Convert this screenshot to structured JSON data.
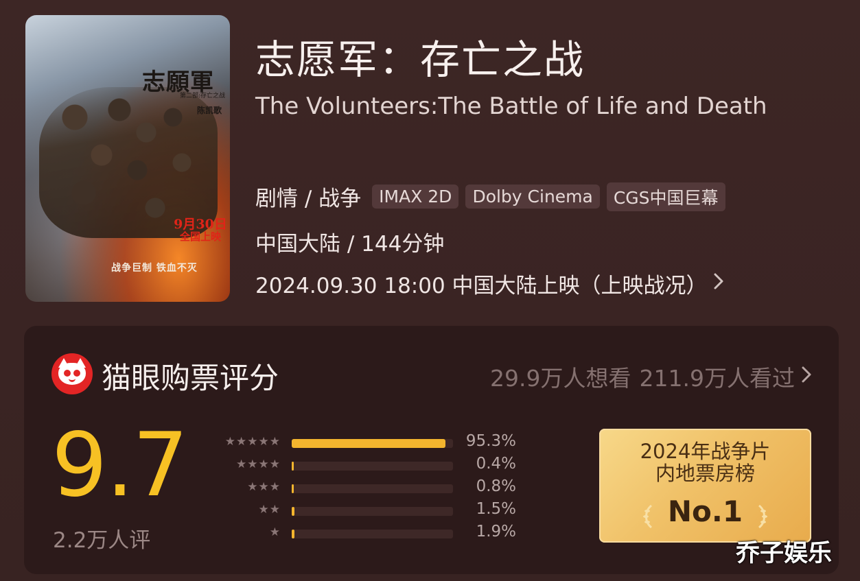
{
  "poster": {
    "title": "志願軍",
    "subtitle": "第二部:存亡之战",
    "director": "陈凯歌",
    "date_line1": "9月30日",
    "date_line2": "全国上映",
    "slogan": "战争巨制 铁血不灭"
  },
  "movie": {
    "title_cn": "志愿军：存亡之战",
    "title_en": "The Volunteers:The Battle of Life and Death",
    "genre": "剧情 / 战争",
    "tags": [
      "IMAX 2D",
      "Dolby Cinema",
      "CGS中国巨幕"
    ],
    "region_duration": "中国大陆 / 144分钟",
    "release": "2024.09.30 18:00 中国大陆上映（上映战况）"
  },
  "rating": {
    "title": "猫眼购票评分",
    "want": "29.9万人想看",
    "watched": "211.9万人看过",
    "score": "9.7",
    "voters": "2.2万人评",
    "distribution": [
      {
        "stars": "★★★★★",
        "percent_label": "95.3%",
        "value": 95.3
      },
      {
        "stars": "★★★★",
        "percent_label": "0.4%",
        "value": 0.4
      },
      {
        "stars": "★★★",
        "percent_label": "0.8%",
        "value": 0.8
      },
      {
        "stars": "★★",
        "percent_label": "1.5%",
        "value": 1.5
      },
      {
        "stars": "★",
        "percent_label": "1.9%",
        "value": 1.9
      }
    ]
  },
  "rank_badge": {
    "line1": "2024年战争片",
    "line2": "内地票房榜",
    "rank": "No.1"
  },
  "watermark": "乔子娱乐",
  "colors": {
    "background": "#3a2423",
    "card": "#2c1a1a",
    "score": "#f7c124",
    "bar_fill": "#f4b52e",
    "logo": "#e32525",
    "badge": "#f0c168"
  },
  "icons": {
    "chevron": "chevron-right-icon",
    "logo": "maoyan-cat-logo-icon",
    "star": "star-icon",
    "laurel": "laurel-icon"
  }
}
